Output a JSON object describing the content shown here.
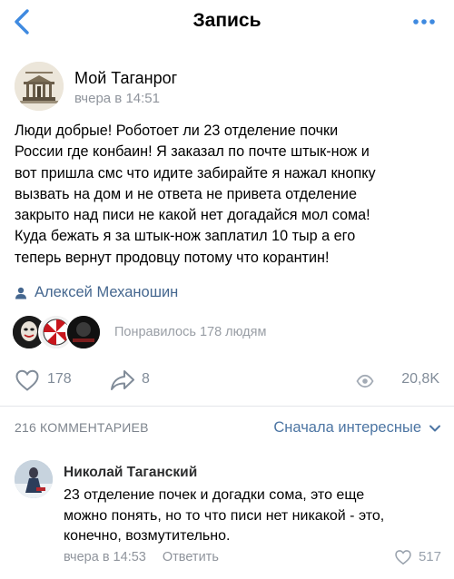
{
  "nav": {
    "title": "Запись",
    "back_icon": "chevron-left-icon",
    "more_icon": "more-horizontal-icon"
  },
  "post": {
    "group_name": "Мой Таганрог",
    "time": "вчера в 14:51",
    "text_lines": [
      "Люди добрые! Роботоет ли 23 отделение почки",
      "России где конбаин! Я заказал по почте штык-нож и",
      "вот пришла смс что идите забирайте я нажал кнопку",
      "вызвать на дом и не ответа не привета отделение",
      "закрыто над писи не какой нет догадайся мол сома!",
      "Куда бежать я за штык-нож заплатил 10 тыр а его",
      "теперь вернут продовцу потому что корантин!"
    ],
    "author": "Алексей Механошин",
    "liked_by": "Понравилось 178 людям",
    "likes": "178",
    "shares": "8",
    "views": "20,8K"
  },
  "comments": {
    "count_label": "216 КОММЕНТАРИЕВ",
    "sort_label": "Сначала интересные",
    "items": [
      {
        "author": "Николай Таганский",
        "text_lines": [
          "23 отделение почек и догадки сома, это еще",
          "можно понять, но то что писи нет никакой - это,",
          "конечно, возмутительно."
        ],
        "time": "вчера в 14:53",
        "reply": "Ответить",
        "likes": "517"
      }
    ]
  },
  "colors": {
    "link": "#4c75a3",
    "author_link": "#45678f",
    "meta": "#8f949c",
    "icon": "#818c99"
  }
}
